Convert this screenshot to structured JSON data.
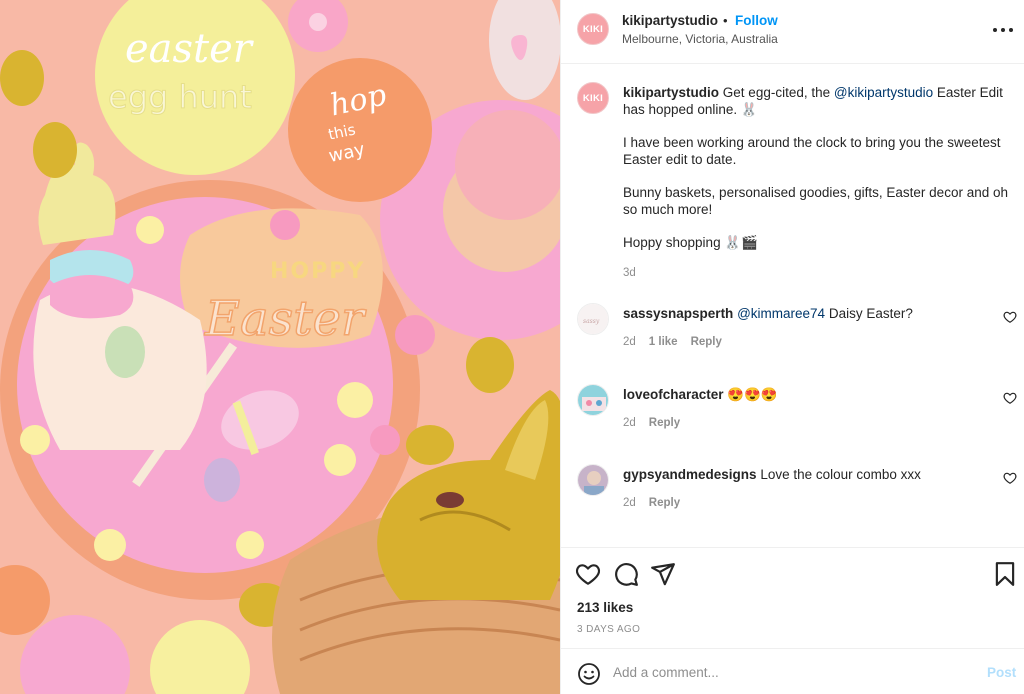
{
  "post": {
    "image_alt": "Pastel Easter flat lay with acrylic toppers, cupcakes and a gold chocolate bunny",
    "image_text": {
      "topper1_line1": "easter",
      "topper1_line2": "egg hunt",
      "topper2_line1": "hop",
      "topper2_line2": "this",
      "topper2_line3": "way",
      "topper3_line1": "HOPPY",
      "topper3_line2": "Easter"
    }
  },
  "header": {
    "avatar_text": "KIKI",
    "username": "kikipartystudio",
    "separator": "•",
    "follow_label": "Follow",
    "location": "Melbourne, Victoria, Australia",
    "more_icon": "more-horizontal-icon"
  },
  "caption": {
    "avatar_text": "KIKI",
    "username": "kikipartystudio",
    "text_part1": "Get egg-cited, the ",
    "mention": "@kikipartystudio",
    "text_part2": " Easter Edit has hopped online. 🐰",
    "paragraph2": "I have been working around the clock to bring you the sweetest Easter edit to date.",
    "paragraph3": "Bunny baskets, personalised goodies, gifts, Easter decor and oh so much more!",
    "paragraph4": "Hoppy shopping 🐰🎬",
    "time": "3d"
  },
  "comments": [
    {
      "username": "sassysnapsperth",
      "mention": "@kimmaree74",
      "text": " Daisy Easter?",
      "time": "2d",
      "likes": "1 like",
      "reply_label": "Reply"
    },
    {
      "username": "loveofcharacter",
      "mention": "",
      "text": "😍😍😍",
      "time": "2d",
      "reply_label": "Reply"
    },
    {
      "username": "gypsyandmedesigns",
      "mention": "",
      "text": "Love the colour combo xxx",
      "time": "2d",
      "reply_label": "Reply"
    }
  ],
  "actions": {
    "like_icon": "heart-icon",
    "comment_icon": "comment-icon",
    "share_icon": "share-icon",
    "save_icon": "bookmark-icon",
    "likes": "213 likes",
    "date": "3 DAYS AGO"
  },
  "add_comment": {
    "placeholder": "Add a comment...",
    "post_label": "Post",
    "emoji_icon": "smiley-icon"
  },
  "colors": {
    "link_blue": "#0095f6",
    "mention_blue": "#00376b",
    "post_disabled": "#b2dffc",
    "muted": "#8e8e8e",
    "avatar_pink": "#f6a3a8"
  }
}
